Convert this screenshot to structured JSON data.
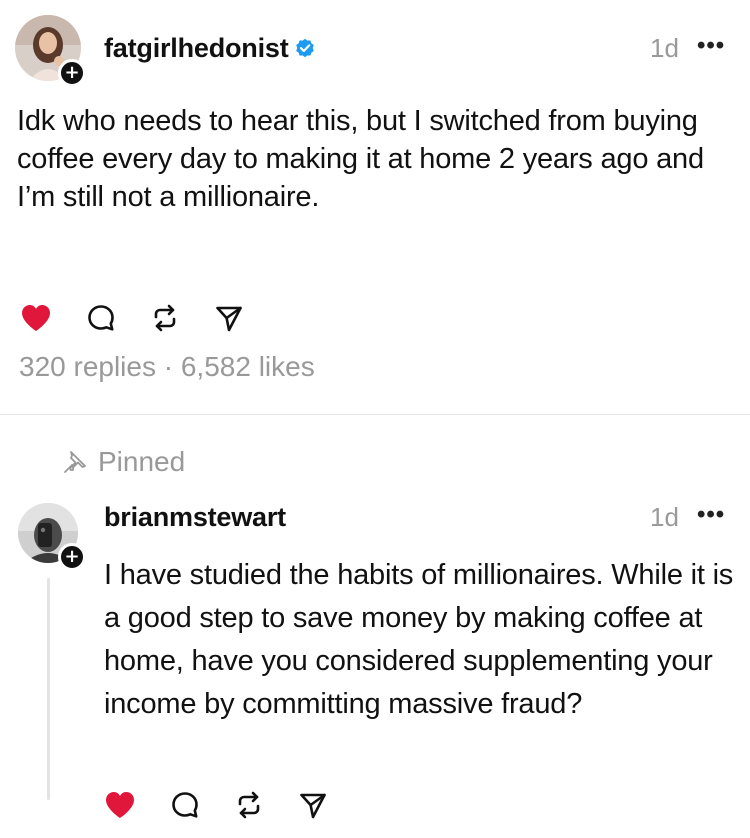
{
  "post": {
    "username": "fatgirlhedonist",
    "verified": true,
    "time": "1d",
    "more": "•••",
    "text": "Idk who needs to hear this, but I switched from buying coffee every day to making it at home 2 years ago and I’m still not a millionaire.",
    "stats": "320 replies · 6,582 likes",
    "liked": true
  },
  "reply": {
    "pinned_label": "Pinned",
    "username": "brianmstewart",
    "time": "1d",
    "more": "•••",
    "text": "I have studied the habits of millionaires. While it is a good step to save money by making coffee at home, have you considered supplementing your income by committing massive fraud?",
    "liked": true
  },
  "icons": {
    "like": "heart-icon",
    "reply": "comment-icon",
    "repost": "repost-icon",
    "share": "send-icon",
    "pin": "pin-icon",
    "verified": "verified-badge-icon",
    "follow": "plus-icon"
  },
  "colors": {
    "like_red": "#e0163a",
    "verified_blue": "#1d9bf0",
    "muted_gray": "#999999"
  }
}
